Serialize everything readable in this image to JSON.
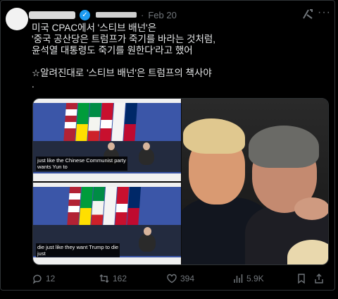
{
  "post": {
    "date": "Feb 20",
    "text_lines": [
      "미국 CPAC에서 '스티브 배넌'은",
      "'중국 공산당은 트럼프가 죽기를 바라는 것처럼,",
      "윤석열 대통령도 죽기를 원한다'라고 했어",
      "",
      "☆알려진대로 '스티브 배넌'은 트럼프의 책사야",
      "."
    ]
  },
  "media": {
    "subtitle_top": "just like the Chinese Communist party\nwants Yun to",
    "subtitle_bottom": "die just like they want Trump to die\njust"
  },
  "actions": {
    "replies": "12",
    "reposts": "162",
    "likes": "394",
    "views": "5.9K"
  },
  "icons": {
    "verified": "verified-badge-icon",
    "grok": "grok-icon",
    "more": "more-icon",
    "reply": "reply-icon",
    "repost": "repost-icon",
    "like": "heart-icon",
    "views": "views-icon",
    "bookmark": "bookmark-icon",
    "share": "share-icon"
  },
  "colors": {
    "background": "#000000",
    "text": "#e7e9ea",
    "muted": "#71767b",
    "accent": "#1d9bf0"
  }
}
